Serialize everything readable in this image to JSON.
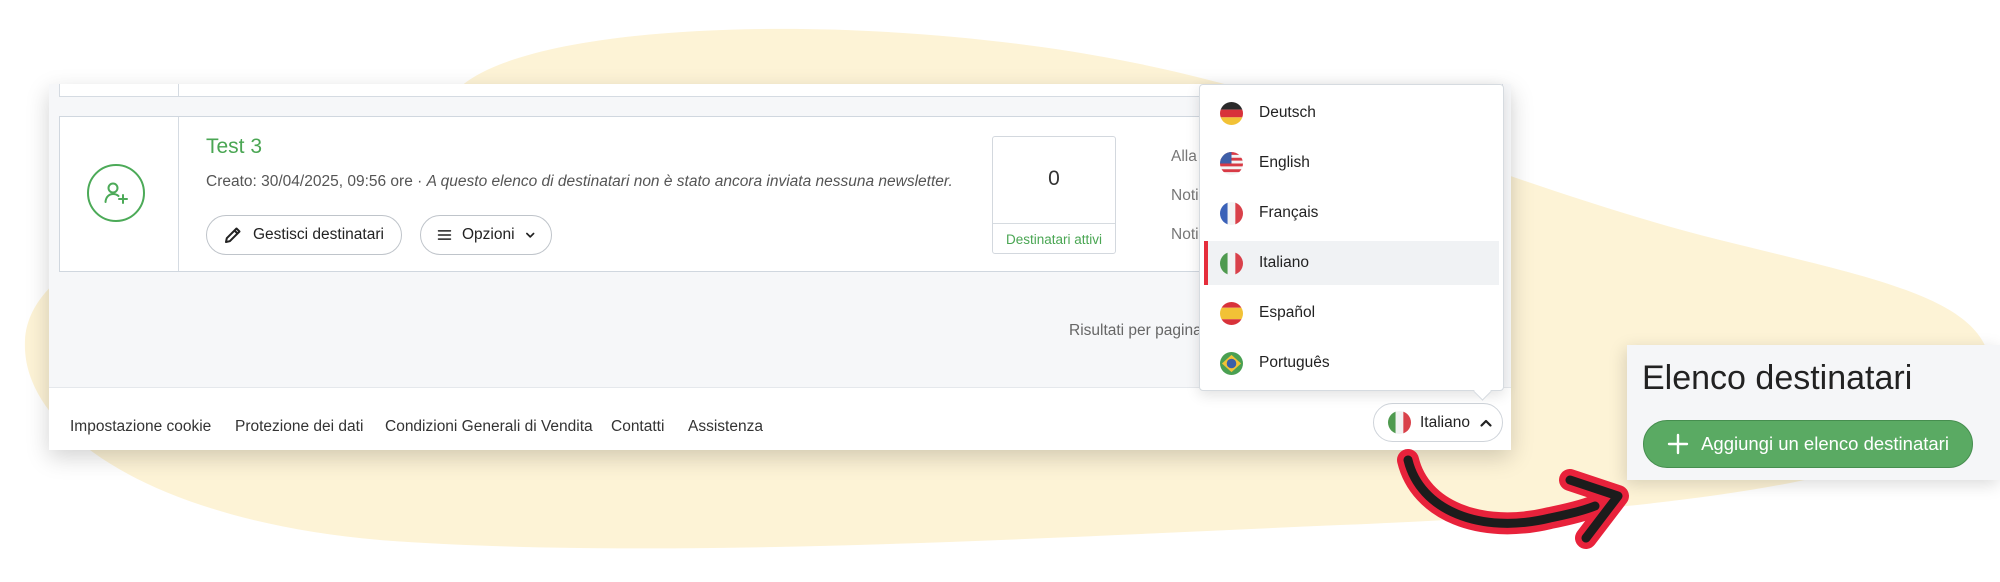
{
  "list": {
    "title": "Test 3",
    "meta_created": "Creato: 30/04/2025, 09:56 ore · ",
    "meta_note": "A questo elenco di destinatari non è stato ancora inviata nessuna newsletter.",
    "manage_label": "Gestisci destinatari",
    "options_label": "Opzioni",
    "active_count": "0",
    "active_label": "Destinatari attivi",
    "notif_1": "Alla",
    "notif_2": "Noti",
    "notif_3": "Noti"
  },
  "pagination": {
    "results_label": "Risultati per pagina"
  },
  "footer": {
    "links": [
      "Impostazione cookie",
      "Protezione dei dati",
      "Condizioni Generali di Vendita",
      "Contatti",
      "Assistenza"
    ],
    "language_label": "Italiano"
  },
  "language_menu": {
    "options": [
      {
        "label": "Deutsch",
        "flag": "germany-flag"
      },
      {
        "label": "English",
        "flag": "usa-flag"
      },
      {
        "label": "Français",
        "flag": "france-flag"
      },
      {
        "label": "Italiano",
        "flag": "italy-flag",
        "selected": true
      },
      {
        "label": "Español",
        "flag": "spain-flag"
      },
      {
        "label": "Português",
        "flag": "brazil-flag"
      }
    ]
  },
  "side_panel": {
    "title": "Elenco destinatari",
    "add_button_label": "Aggiungi un elenco destinatari"
  },
  "colors": {
    "accent_green": "#4aa653",
    "button_green": "#5aaa63",
    "selected_marker": "#e52d3b",
    "background_blob": "#fdf3d6",
    "arrow_red": "#e8223b"
  }
}
